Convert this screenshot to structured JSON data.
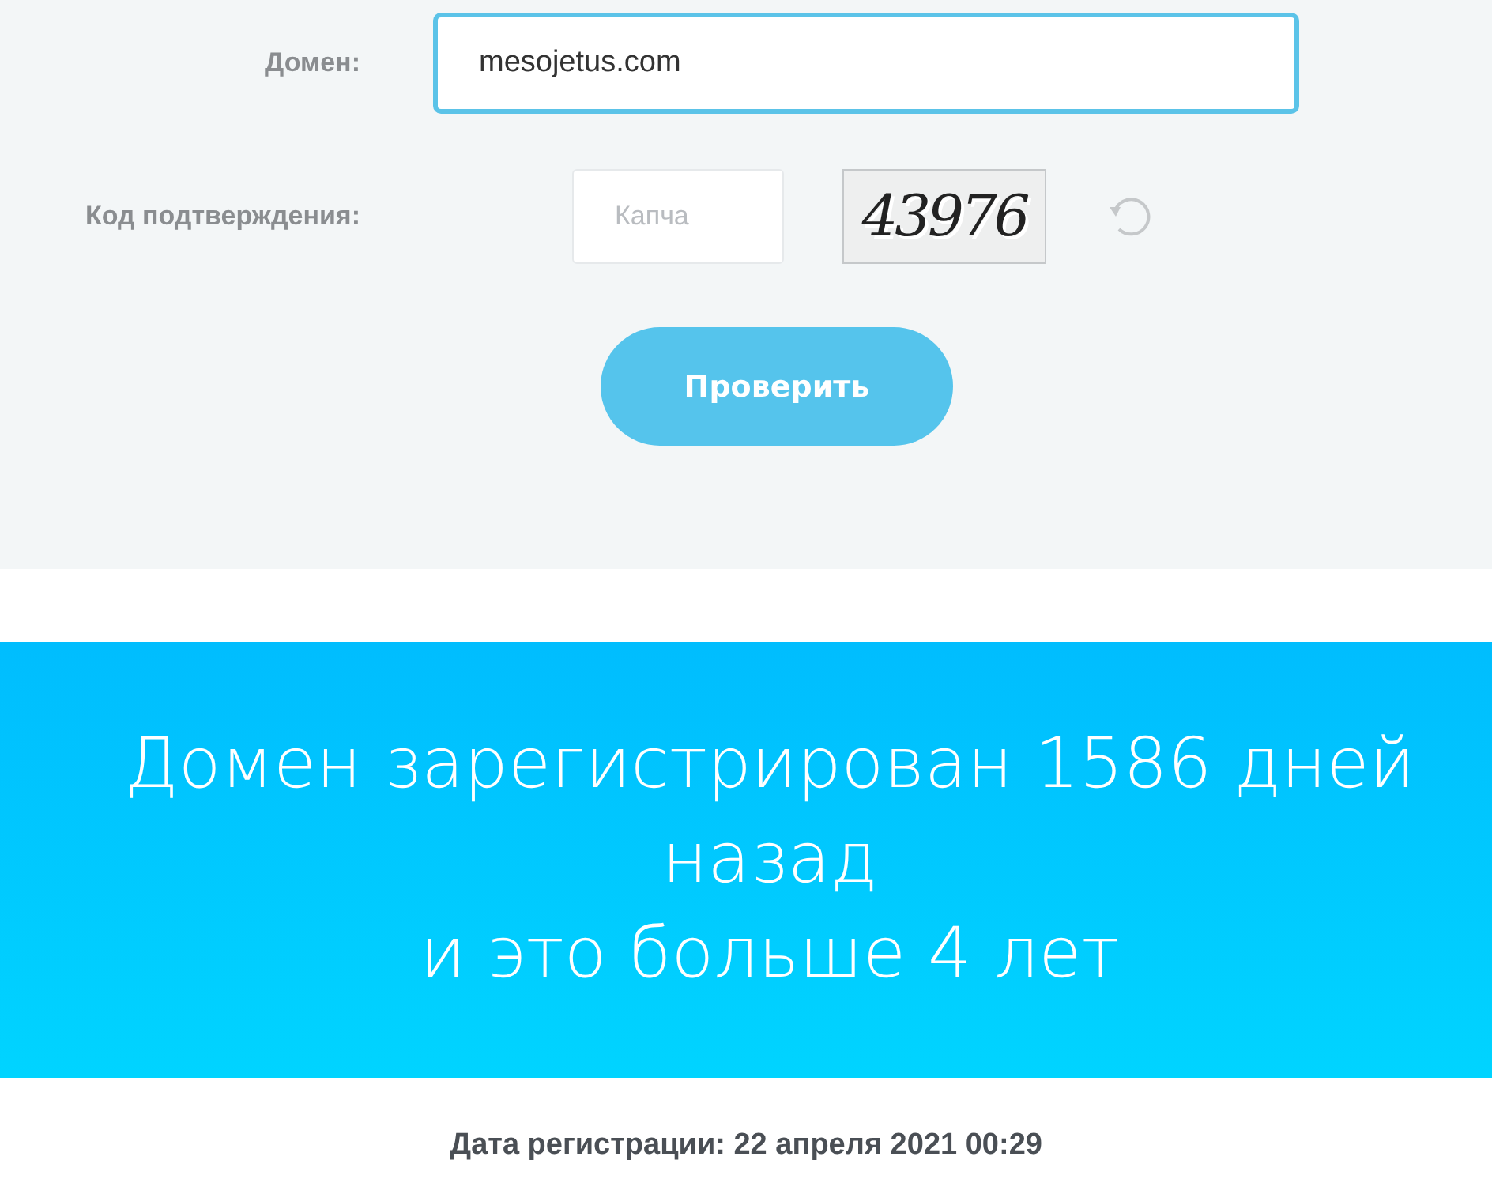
{
  "form": {
    "domain": {
      "label": "Домен:",
      "value": "mesojetus.com",
      "focused": true
    },
    "captcha": {
      "label": "Код подтверждения:",
      "placeholder": "Капча",
      "code": "43976"
    },
    "submit": "Проверить"
  },
  "banner": {
    "lines": [
      "Домен зарегистрирован 1586 дней назад",
      "и это больше 4 лет"
    ]
  },
  "registration": "Дата регистрации: 22 апреля 2021 00:29"
}
